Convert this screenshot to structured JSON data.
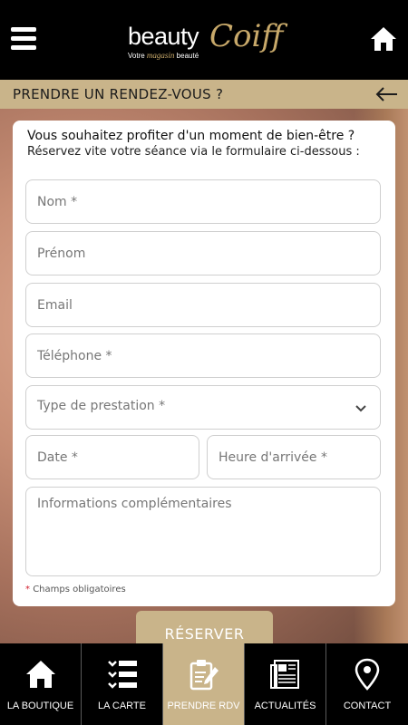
{
  "header": {
    "logo_main": "beauty",
    "logo_script": "Coiff",
    "logo_sub_prefix": "Votre",
    "logo_sub_italic": "magasin",
    "logo_sub_suffix": "beauté"
  },
  "titlebar": {
    "title": "PRENDRE UN RENDEZ-VOUS ?"
  },
  "form": {
    "intro_line1": "Vous souhaitez profiter d'un moment de bien-être ?",
    "intro_line2": "Réservez vite votre séance via le formulaire ci-dessous :",
    "nom_placeholder": "Nom *",
    "prenom_placeholder": "Prénom",
    "email_placeholder": "Email",
    "telephone_placeholder": "Téléphone *",
    "prestation_label": "Type de prestation *",
    "date_placeholder": "Date *",
    "heure_placeholder": "Heure d'arrivée *",
    "infos_placeholder": "Informations complémentaires",
    "note_star": "*",
    "note_text": "Champs obligatoires",
    "submit_label": "RÉSERVER"
  },
  "nav": {
    "items": [
      {
        "label": "LA BOUTIQUE",
        "icon": "home-icon",
        "active": false
      },
      {
        "label": "LA CARTE",
        "icon": "list-icon",
        "active": false
      },
      {
        "label": "PRENDRE RDV",
        "icon": "clipboard-icon",
        "active": true
      },
      {
        "label": "ACTUALITÉS",
        "icon": "newspaper-icon",
        "active": false
      },
      {
        "label": "CONTACT",
        "icon": "map-pin-icon",
        "active": false
      }
    ]
  },
  "colors": {
    "accent": "#c9b48a",
    "header_bg": "#000000",
    "required_star": "#d2202f"
  }
}
